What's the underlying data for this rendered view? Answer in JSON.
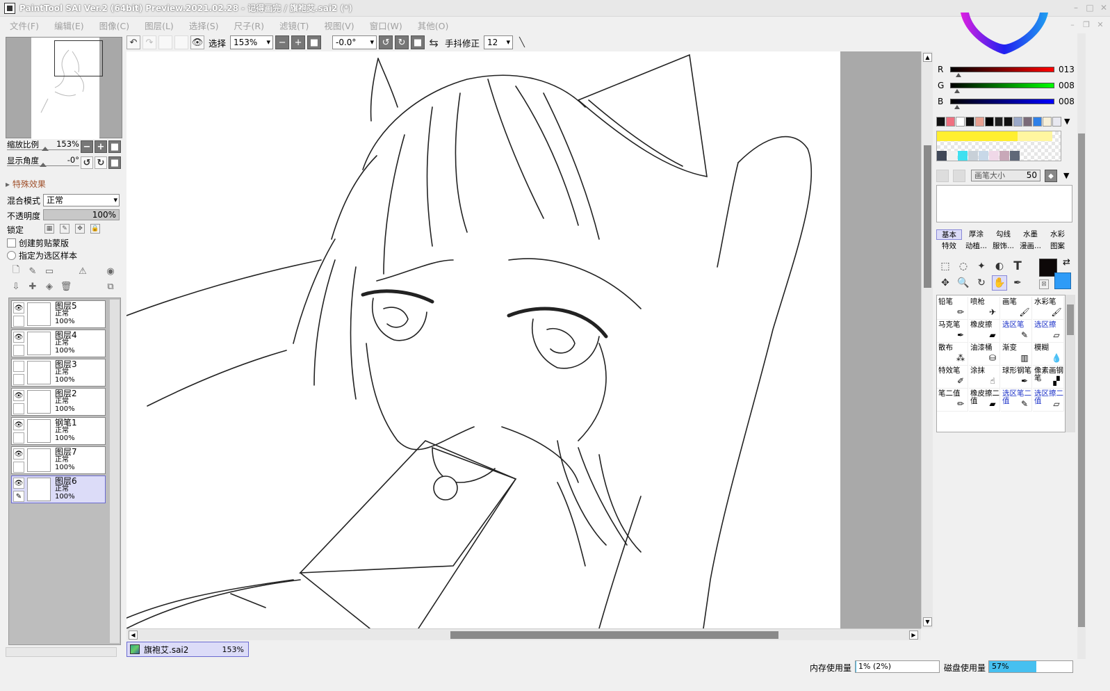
{
  "window": {
    "title": "PaintTool SAI Ver.2 (64bit) Preview.2021.02.28 - 记得画完 / 旗袍艾.sai2 (*)"
  },
  "menu": [
    "文件(F)",
    "编辑(E)",
    "图像(C)",
    "图层(L)",
    "选择(S)",
    "尺子(R)",
    "滤镜(T)",
    "视图(V)",
    "窗口(W)",
    "其他(O)"
  ],
  "navigator": {
    "zoom_label": "缩放比例",
    "zoom_value": "153%",
    "angle_label": "显示角度",
    "angle_value": "-0°",
    "zoom_fraction": 0.4,
    "angle_fraction": 0.5
  },
  "layer_props": {
    "section_title": "特殊效果",
    "blend_label": "混合模式",
    "blend_value": "正常",
    "opacity_label": "不透明度",
    "opacity_value": "100%",
    "lock_label": "锁定",
    "clip_label": "创建剪贴蒙版",
    "selection_source_label": "指定为选区样本"
  },
  "layers": [
    {
      "name": "图层5",
      "mode": "正常",
      "opacity": "100%",
      "visible": true,
      "selected": false,
      "pen": false
    },
    {
      "name": "图层4",
      "mode": "正常",
      "opacity": "100%",
      "visible": true,
      "selected": false,
      "pen": false
    },
    {
      "name": "图层3",
      "mode": "正常",
      "opacity": "100%",
      "visible": false,
      "selected": false,
      "pen": false
    },
    {
      "name": "图层2",
      "mode": "正常",
      "opacity": "100%",
      "visible": true,
      "selected": false,
      "pen": false
    },
    {
      "name": "钢笔1",
      "mode": "正常",
      "opacity": "100%",
      "visible": true,
      "selected": false,
      "pen": true
    },
    {
      "name": "图层7",
      "mode": "正常",
      "opacity": "100%",
      "visible": true,
      "selected": false,
      "pen": false
    },
    {
      "name": "图层6",
      "mode": "正常",
      "opacity": "100%",
      "visible": true,
      "selected": true,
      "pen": false
    }
  ],
  "toolbar": {
    "select_label": "选择",
    "zoom_value": "153%",
    "angle_value": "-0.0°",
    "stabilizer_label": "手抖修正",
    "stabilizer_value": "12"
  },
  "document_tab": {
    "name": "旗袍艾.sai2",
    "zoom": "153%"
  },
  "color": {
    "r_label": "R",
    "r_value": "013",
    "g_label": "G",
    "g_value": "008",
    "b_label": "B",
    "b_value": "008",
    "foreground": "#0d0808",
    "background": "#2e9bf7",
    "swatches": [
      "#111111",
      "#f07080",
      "#ffffff",
      "#111111",
      "#e8a090",
      "#000000",
      "#202020",
      "#111111",
      "#9aa8c8",
      "#7a6a78",
      "#2e80e8",
      "#f8f0d8",
      "#e8e8f0"
    ],
    "swatch_row3": [
      "#404858",
      "#f0f0f0",
      "#40e0f0",
      "#c8d0d8",
      "#c8d8e8",
      "#f0d8e8",
      "#c8a8b8",
      "#606878"
    ]
  },
  "brush": {
    "size_label": "画笔大小",
    "size_value": "50",
    "tabs": [
      "基本",
      "厚涂",
      "勾线",
      "水墨",
      "水彩",
      "特效",
      "动植...",
      "服饰...",
      "漫画...",
      "图案"
    ],
    "active_tab": "基本",
    "tools": [
      {
        "name": "铅笔",
        "icon": "pencil-icon",
        "blue": false
      },
      {
        "name": "喷枪",
        "icon": "airbrush-icon",
        "blue": false
      },
      {
        "name": "画笔",
        "icon": "brush-icon",
        "blue": false
      },
      {
        "name": "水彩笔",
        "icon": "watercolor-icon",
        "blue": false
      },
      {
        "name": "马克笔",
        "icon": "marker-icon",
        "blue": false
      },
      {
        "name": "橡皮擦",
        "icon": "eraser-icon",
        "blue": false
      },
      {
        "name": "选区笔",
        "icon": "selection-pen-icon",
        "blue": true
      },
      {
        "name": "选区擦",
        "icon": "selection-eraser-icon",
        "blue": true
      },
      {
        "name": "散布",
        "icon": "scatter-icon",
        "blue": false
      },
      {
        "name": "油漆桶",
        "icon": "bucket-icon",
        "blue": false
      },
      {
        "name": "渐变",
        "icon": "gradient-icon",
        "blue": false
      },
      {
        "name": "模糊",
        "icon": "blur-icon",
        "blue": false
      },
      {
        "name": "特效笔",
        "icon": "effect-pen-icon",
        "blue": false
      },
      {
        "name": "涂抹",
        "icon": "smudge-icon",
        "blue": false
      },
      {
        "name": "球形钢笔",
        "icon": "ball-pen-icon",
        "blue": false
      },
      {
        "name": "像素画钢笔",
        "icon": "pixel-pen-icon",
        "blue": false
      },
      {
        "name": "笔二值",
        "icon": "binary-pen-icon",
        "blue": false
      },
      {
        "name": "橡皮擦二值",
        "icon": "binary-eraser-icon",
        "blue": false
      },
      {
        "name": "选区笔二值",
        "icon": "binary-selection-pen-icon",
        "blue": true
      },
      {
        "name": "选区擦二值",
        "icon": "binary-selection-eraser-icon",
        "blue": true
      }
    ]
  },
  "status": {
    "memory_label": "内存使用量",
    "memory_value": "1% (2%)",
    "memory_fraction": 0.01,
    "disk_label": "磁盘使用量",
    "disk_value": "57%",
    "disk_fraction": 0.57
  }
}
